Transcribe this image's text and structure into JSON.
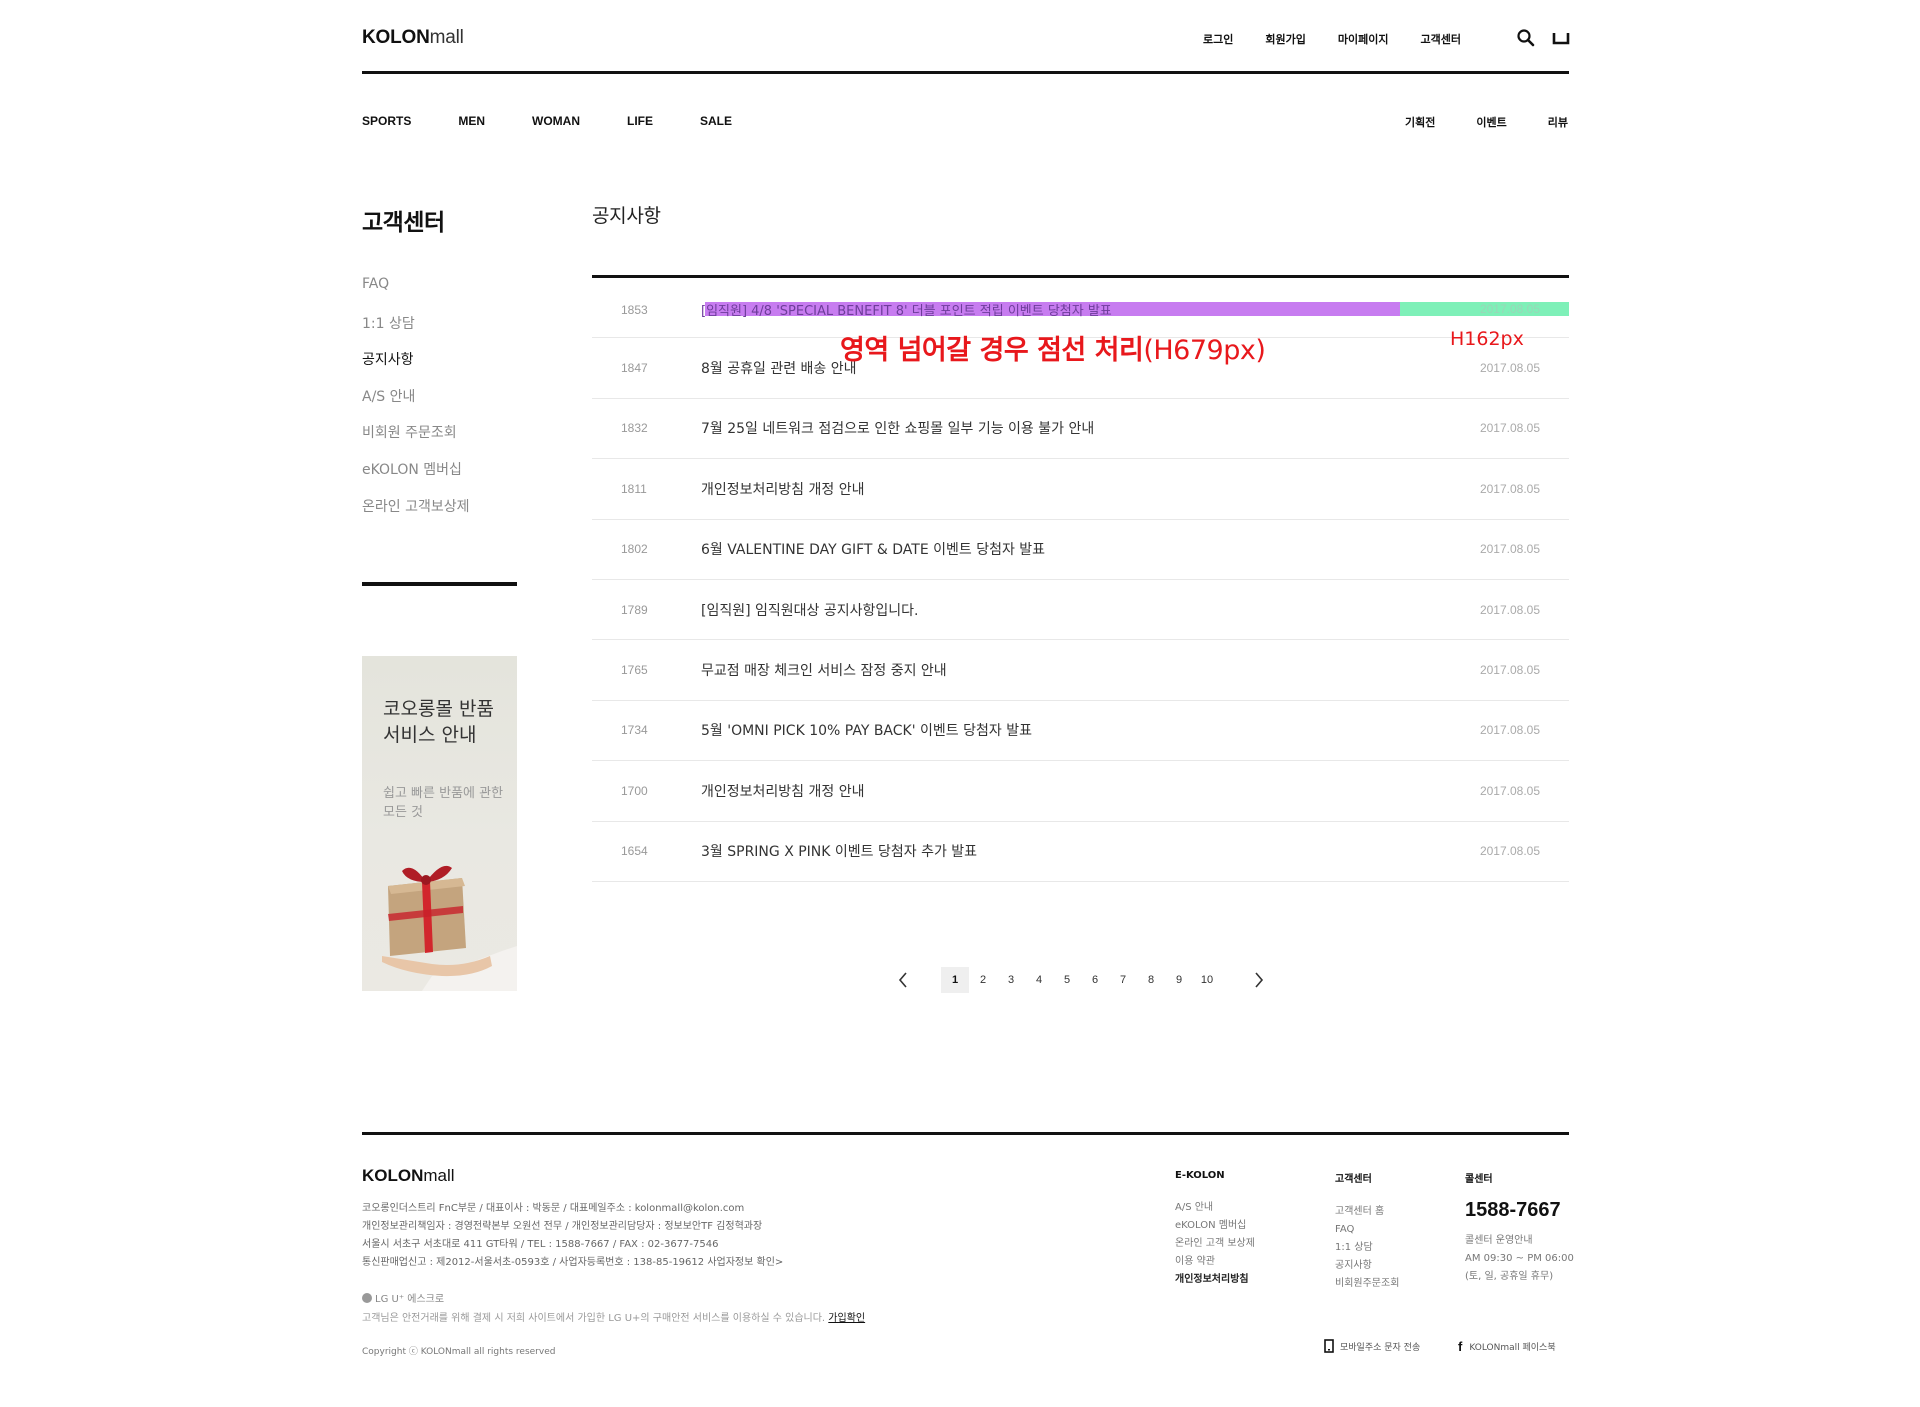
{
  "header": {
    "logo_bold": "KOLON",
    "logo_light": "mall",
    "util": [
      "로그인",
      "회원가입",
      "마이페이지",
      "고객센터"
    ],
    "icons": [
      "search-icon",
      "bag-icon"
    ]
  },
  "gnb": {
    "main": [
      "SPORTS",
      "MEN",
      "WOMAN",
      "LIFE",
      "SALE"
    ],
    "sub": [
      "기획전",
      "이벤트",
      "리뷰"
    ]
  },
  "sidebar": {
    "title": "고객센터",
    "items": [
      {
        "label": "FAQ",
        "active": false
      },
      {
        "label": "1:1 상담",
        "active": false
      },
      {
        "label": "공지사항",
        "active": true
      },
      {
        "label": "A/S 안내",
        "active": false
      },
      {
        "label": "비회원 주문조회",
        "active": false
      },
      {
        "label": "eKOLON 멤버십",
        "active": false
      },
      {
        "label": "온라인 고객보상제",
        "active": false
      }
    ],
    "banner": {
      "title": "코오롱몰 반품 서비스 안내",
      "subtitle": "쉽고 빠른 반품에 관한 모든 것"
    }
  },
  "main": {
    "title": "공지사항",
    "notices": [
      {
        "num": "1853",
        "subject": "[임직원] 4/8 'SPECIAL BENEFIT 8' 더블 포인트 적립 이벤트 당첨자 발표",
        "date": "2017.08.05"
      },
      {
        "num": "1847",
        "subject": "8월 공휴일 관련 배송 안내",
        "date": "2017.08.05"
      },
      {
        "num": "1832",
        "subject": "7월 25일 네트워크 점검으로 인한 쇼핑몰 일부 기능 이용 불가 안내",
        "date": "2017.08.05"
      },
      {
        "num": "1811",
        "subject": "개인정보처리방침 개정 안내",
        "date": "2017.08.05"
      },
      {
        "num": "1802",
        "subject": "6월 VALENTINE DAY GIFT & DATE 이벤트 당첨자 발표",
        "date": "2017.08.05"
      },
      {
        "num": "1789",
        "subject": "[임직원] 임직원대상 공지사항입니다.",
        "date": "2017.08.05"
      },
      {
        "num": "1765",
        "subject": "무교점 매장 체크인 서비스 잠정 중지 안내",
        "date": "2017.08.05"
      },
      {
        "num": "1734",
        "subject": "5월 'OMNI PICK 10% PAY BACK' 이벤트 당첨자 발표",
        "date": "2017.08.05"
      },
      {
        "num": "1700",
        "subject": "개인정보처리방침 개정 안내",
        "date": "2017.08.05"
      },
      {
        "num": "1654",
        "subject": "3월 SPRING X PINK 이벤트 당첨자 추가 발표",
        "date": "2017.08.05"
      }
    ],
    "annotation_main_bold": "영역 넘어갈 경우 점선 처리",
    "annotation_main_light": "(H679px)",
    "annotation_date": "H162px"
  },
  "paging": {
    "pages": [
      "1",
      "2",
      "3",
      "4",
      "5",
      "6",
      "7",
      "8",
      "9",
      "10"
    ],
    "current": "1"
  },
  "footer": {
    "logo_bold": "KOLON",
    "logo_light": "mall",
    "info": [
      "코오롱인더스트리 FnC부문 / 대표이사 : 박동문 / 대표메일주소 : kolonmall@kolon.com",
      "개인정보관리책임자 : 경영전략본부 오원선 전무 / 개인정보관리담당자 : 정보보안TF 김정혁과장",
      "서울시 서초구 서초대로 411 GT타워 / TEL : 1588-7667 / FAX : 02-3677-7546",
      "통신판매업신고 : 제2012-서울서초-0593호 / 사업자등록번호 : 138-85-19612  사업자정보 확인>"
    ],
    "lgu_label": "LG U⁺ 에스크로",
    "lgu_text": "고객님은 안전거래를 위해 결제 시 저희 사이트에서 가입한 LG U+의 구매안전 서비스를 이용하실 수 있습니다.",
    "lgu_link": "가입확인",
    "copyright": "Copyright ⓒ KOLONmall all rights reserved",
    "col_ekolon": {
      "title": "E-KOLON",
      "items": [
        "A/S 안내",
        "eKOLON 멤버십",
        "온라인 고객 보상제",
        "이용 약관",
        "개인정보처리방침"
      ]
    },
    "col_cs": {
      "title": "고객센터",
      "items": [
        "고객센터 홈",
        "FAQ",
        "1:1 상담",
        "공지사항",
        "비회원주문조회"
      ]
    },
    "col_call": {
      "title": "콜센터",
      "number": "1588-7667",
      "info": [
        "콜센터 운영안내",
        "AM 09:30 ~ PM 06:00",
        "(토, 일, 공휴일 휴무)"
      ]
    },
    "mobile_link": "모바일주소 문자 전송",
    "facebook_link": "KOLONmall 페이스북"
  }
}
